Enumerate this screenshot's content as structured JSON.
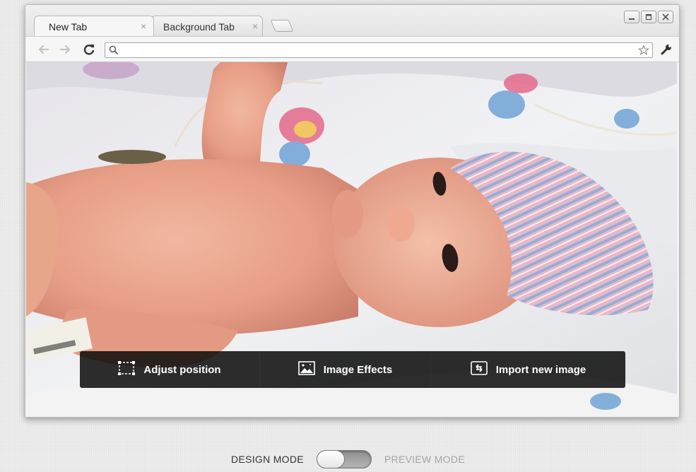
{
  "tabs": [
    {
      "label": "New Tab",
      "active": true
    },
    {
      "label": "Background Tab",
      "active": false
    }
  ],
  "tab_close_glyph": "×",
  "window_controls": [
    "minimize-icon",
    "maximize-icon",
    "close-icon"
  ],
  "toolbar": {
    "icons": [
      "back-arrow-icon",
      "forward-arrow-icon",
      "reload-icon",
      "search-icon",
      "star-icon",
      "wrench-icon"
    ],
    "omnibox_value": ""
  },
  "photo_actions": [
    {
      "label": "Adjust position",
      "icon": "crop-frame-icon"
    },
    {
      "label": "Image Effects",
      "icon": "image-icon"
    },
    {
      "label": "Import new image",
      "icon": "import-icon"
    }
  ],
  "mode_switch": {
    "left_label": "DESIGN MODE",
    "right_label": "PREVIEW MODE",
    "selected": "DESIGN MODE"
  },
  "colors": {
    "action_bar": "#0c0c0c",
    "active_mode_text": "#333333",
    "inactive_mode_text": "#a5a5a5"
  }
}
